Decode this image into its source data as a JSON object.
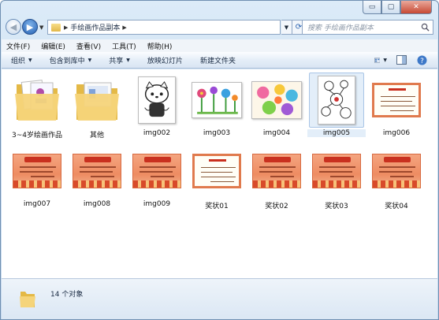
{
  "window": {
    "caption": {
      "minimize": "▭",
      "maximize": "▢",
      "close": "✕"
    }
  },
  "address": {
    "crumbs": [
      "手绘画作品副本"
    ],
    "search_placeholder": "搜索 手绘画作品副本"
  },
  "menu": [
    "文件(F)",
    "编辑(E)",
    "查看(V)",
    "工具(T)",
    "帮助(H)"
  ],
  "toolbar": {
    "organize": "组织",
    "include": "包含到库中",
    "share": "共享",
    "slideshow": "放映幻灯片",
    "new_folder": "新建文件夹"
  },
  "items": [
    {
      "label": "3~4岁绘画作品",
      "kind": "folder"
    },
    {
      "label": "其他",
      "kind": "folder"
    },
    {
      "label": "img002",
      "kind": "kitty"
    },
    {
      "label": "img003",
      "kind": "flowers"
    },
    {
      "label": "img004",
      "kind": "colorful"
    },
    {
      "label": "img005",
      "kind": "sketch",
      "selected": true
    },
    {
      "label": "img006",
      "kind": "cert-white"
    },
    {
      "label": "img007",
      "kind": "cert"
    },
    {
      "label": "img008",
      "kind": "cert"
    },
    {
      "label": "img009",
      "kind": "cert"
    },
    {
      "label": "奖状01",
      "kind": "cert-white"
    },
    {
      "label": "奖状02",
      "kind": "cert"
    },
    {
      "label": "奖状03",
      "kind": "cert"
    },
    {
      "label": "奖状04",
      "kind": "cert"
    }
  ],
  "status": {
    "count_text": "14 个对象"
  },
  "colors": {
    "accent": "#2560b2",
    "folder": "#e9c55a",
    "cert_orange": "#ee8c62"
  }
}
